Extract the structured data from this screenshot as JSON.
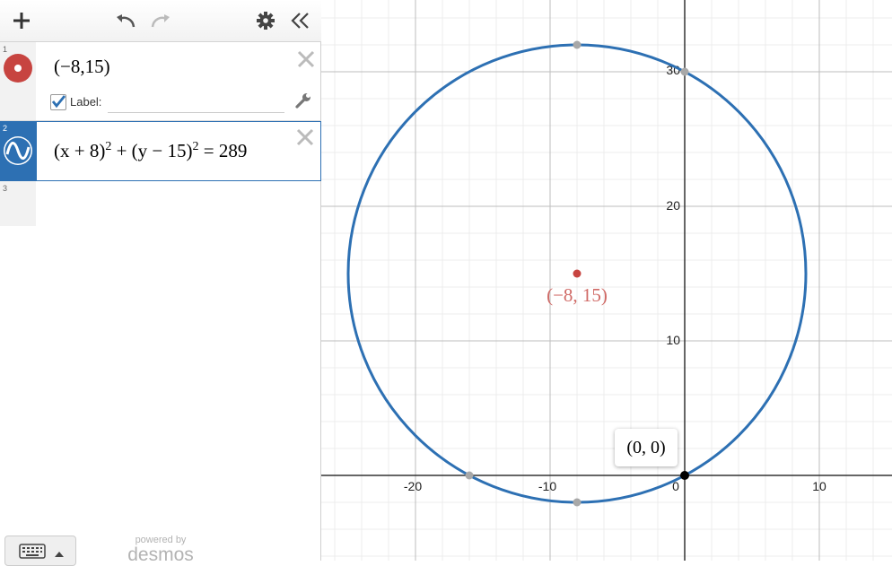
{
  "toolbar": {
    "add_icon": "plus-icon",
    "undo_icon": "undo-icon",
    "redo_icon": "redo-icon",
    "settings_icon": "gear-icon",
    "collapse_icon": "double-chevron-left-icon"
  },
  "expressions": [
    {
      "index": "1",
      "text": "(−8,15)",
      "icon": "point-icon",
      "color": "#c74440",
      "label_checkbox": true,
      "label_text": "Label:",
      "label_value": ""
    },
    {
      "index": "2",
      "parts": {
        "a": "(x + 8)",
        "exp1": "2",
        "b": " + (y − 15)",
        "exp2": "2",
        "c": " = 289"
      },
      "icon": "wave-icon",
      "color": "#2d70b3",
      "selected": true
    },
    {
      "index": "3"
    }
  ],
  "footer": {
    "powered_by": "powered by",
    "brand": "desmos",
    "keyboard_icon": "keyboard-icon"
  },
  "graph": {
    "x_ticks": [
      "-20",
      "-10",
      "0",
      "10"
    ],
    "y_ticks": [
      "10",
      "20",
      "30"
    ],
    "point_label": "(−8, 15)",
    "tooltip": "(0, 0)",
    "point_color": "#c74440",
    "circle_color": "#2d70b3",
    "circle": {
      "cx": -8,
      "cy": 15,
      "r": 17
    }
  }
}
